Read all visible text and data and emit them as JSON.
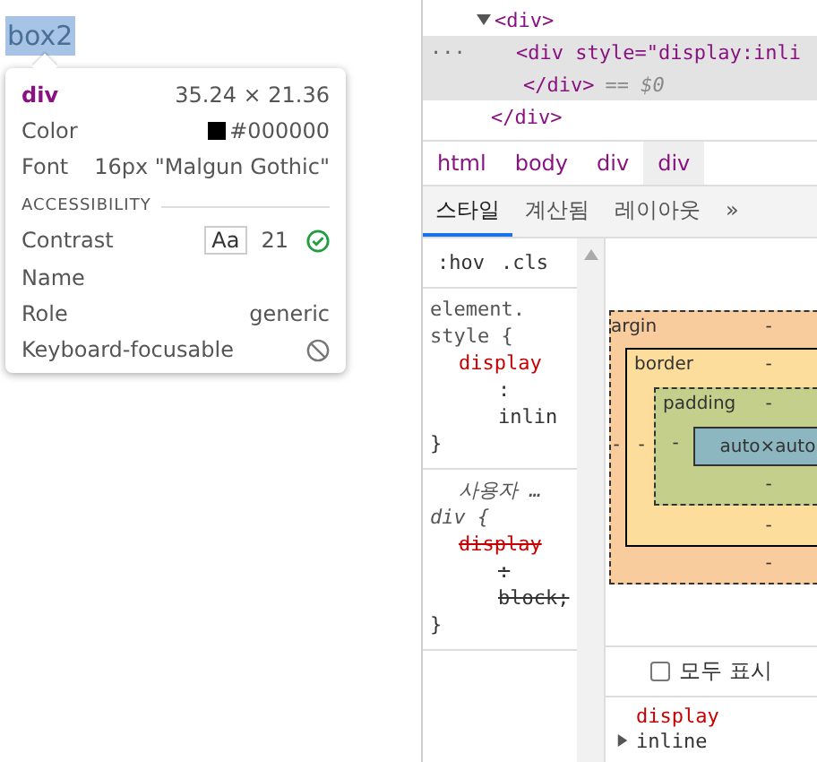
{
  "page": {
    "highlighted_text": "box2"
  },
  "tooltip": {
    "tag": "div",
    "size": "35.24 × 21.36",
    "rows": [
      {
        "label": "Color",
        "value": "#000000",
        "kind": "color"
      },
      {
        "label": "Font",
        "value": "16px \"Malgun Gothic\"",
        "kind": "text"
      }
    ],
    "section": "ACCESSIBILITY",
    "a11y": [
      {
        "label": "Contrast",
        "kind": "contrast",
        "sample": "Aa",
        "value": "21"
      },
      {
        "label": "Name",
        "kind": "text"
      },
      {
        "label": "Role",
        "kind": "text",
        "value": "generic"
      },
      {
        "label": "Keyboard-focusable",
        "kind": "blocked"
      }
    ]
  },
  "elements": [
    {
      "tag": "<div>",
      "expanded": true,
      "selected": false,
      "close": "</div>",
      "children": [
        {
          "tag": "<div style=\"display:inli",
          "selected": true,
          "close": "</div>",
          "note": "== $0",
          "more": "···"
        }
      ]
    }
  ],
  "breadcrumbs": [
    {
      "label": "html",
      "selected": false
    },
    {
      "label": "body",
      "selected": false
    },
    {
      "label": "div",
      "selected": false
    },
    {
      "label": "div",
      "selected": true
    }
  ],
  "tabs": [
    {
      "label": "스타일",
      "selected": true
    },
    {
      "label": "계산됨",
      "selected": false
    },
    {
      "label": "레이아웃",
      "selected": false
    }
  ],
  "tabs_overflow": "»",
  "filter": {
    "hov": ":hov",
    "cls": ".cls"
  },
  "rules": [
    {
      "selector": "element. style {",
      "property": "display",
      "colon": ":",
      "value": "inlin",
      "overridden": false,
      "close": "}"
    },
    {
      "selector": "div {",
      "origin": "사용자 …",
      "property": "display",
      "colon": ":",
      "value": "block;",
      "overridden": true,
      "close": "}"
    }
  ],
  "box_model": {
    "margin": {
      "label": "argin",
      "top": "-",
      "left": "-",
      "bottom": "-"
    },
    "border": {
      "label": "border",
      "top": "-",
      "left": "-",
      "bottom": "-"
    },
    "padding": {
      "label": "padding",
      "top": "-",
      "left": "-",
      "bottom": "-"
    },
    "content": "auto×auto"
  },
  "computed": {
    "show_all": {
      "label": "모두 표시",
      "checked": false
    },
    "properties": [
      {
        "name": "display",
        "value": "inline",
        "expanded": false
      }
    ]
  }
}
